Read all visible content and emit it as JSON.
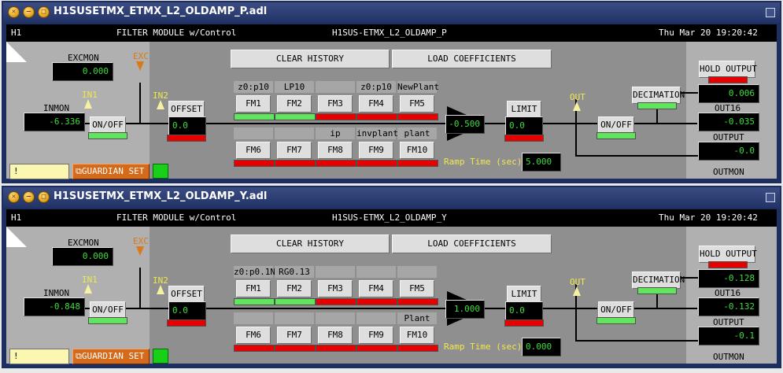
{
  "windows": [
    {
      "title": "H1SUSETMX_ETMX_L2_OLDAMP_P.adl",
      "header": {
        "site": "H1",
        "module_type": "FILTER MODULE w/Control",
        "filter_name": "H1SUS-ETMX_L2_OLDAMP_P",
        "datetime": "Thu Mar 20 19:20:42"
      },
      "excmon": {
        "label": "EXCMON",
        "value": "0.000"
      },
      "exc_label": "EXC",
      "inmon": {
        "label": "INMON",
        "value": "-6.336"
      },
      "in1_label": "IN1",
      "in2_label": "IN2",
      "input_switch": {
        "label": "ON/OFF",
        "state": "on"
      },
      "offset": {
        "label": "OFFSET",
        "value": "0.0",
        "state": "off"
      },
      "clear_history": "CLEAR HISTORY",
      "load_coefficients": "LOAD COEFFICIENTS",
      "filters_top": [
        {
          "name": "z0:p10",
          "button": "FM1",
          "state": "on"
        },
        {
          "name": "LP10",
          "button": "FM2",
          "state": "on"
        },
        {
          "name": "",
          "button": "FM3",
          "state": "off"
        },
        {
          "name": "z0:p10",
          "button": "FM4",
          "state": "off"
        },
        {
          "name": "NewPlant",
          "button": "FM5",
          "state": "off"
        }
      ],
      "filters_bottom": [
        {
          "name": "",
          "button": "FM6",
          "state": "off"
        },
        {
          "name": "",
          "button": "FM7",
          "state": "off"
        },
        {
          "name": "ip",
          "button": "FM8",
          "state": "off"
        },
        {
          "name": "invplant",
          "button": "FM9",
          "state": "off"
        },
        {
          "name": "plant",
          "button": "FM10",
          "state": "off"
        }
      ],
      "gain": "-0.500",
      "limit": {
        "label": "LIMIT",
        "value": "0.0",
        "state": "off"
      },
      "ramp_time": {
        "label": "Ramp Time (sec):",
        "value": "5.000"
      },
      "out_label": "OUT",
      "output_switch": {
        "label": "ON/OFF",
        "state": "on"
      },
      "decimation": {
        "label": "DECIMATION",
        "state": "on"
      },
      "hold_output": {
        "label": "HOLD OUTPUT",
        "state": "off",
        "value": "0.006"
      },
      "out16": {
        "label": "OUT16",
        "value": "-0.035"
      },
      "output": {
        "label": "OUTPUT",
        "value": "-0.0"
      },
      "outmon_label": "OUTMON",
      "status_field": "!",
      "guardian_button": "GUARDIAN SET"
    },
    {
      "title": "H1SUSETMX_ETMX_L2_OLDAMP_Y.adl",
      "header": {
        "site": "H1",
        "module_type": "FILTER MODULE w/Control",
        "filter_name": "H1SUS-ETMX_L2_OLDAMP_Y",
        "datetime": "Thu Mar 20 19:20:42"
      },
      "excmon": {
        "label": "EXCMON",
        "value": "0.000"
      },
      "exc_label": "EXC",
      "inmon": {
        "label": "INMON",
        "value": "-0.848"
      },
      "in1_label": "IN1",
      "in2_label": "IN2",
      "input_switch": {
        "label": "ON/OFF",
        "state": "on"
      },
      "offset": {
        "label": "OFFSET",
        "value": "0.0",
        "state": "off"
      },
      "clear_history": "CLEAR HISTORY",
      "load_coefficients": "LOAD COEFFICIENTS",
      "filters_top": [
        {
          "name": "z0:p0.1N",
          "button": "FM1",
          "state": "on"
        },
        {
          "name": "RG0.13",
          "button": "FM2",
          "state": "on"
        },
        {
          "name": "",
          "button": "FM3",
          "state": "off"
        },
        {
          "name": "",
          "button": "FM4",
          "state": "off"
        },
        {
          "name": "",
          "button": "FM5",
          "state": "off"
        }
      ],
      "filters_bottom": [
        {
          "name": "",
          "button": "FM6",
          "state": "off"
        },
        {
          "name": "",
          "button": "FM7",
          "state": "off"
        },
        {
          "name": "",
          "button": "FM8",
          "state": "off"
        },
        {
          "name": "",
          "button": "FM9",
          "state": "off"
        },
        {
          "name": "Plant",
          "button": "FM10",
          "state": "off"
        }
      ],
      "gain": "1.000",
      "limit": {
        "label": "LIMIT",
        "value": "0.0",
        "state": "off"
      },
      "ramp_time": {
        "label": "Ramp Time (sec):",
        "value": "0.000"
      },
      "out_label": "OUT",
      "output_switch": {
        "label": "ON/OFF",
        "state": "on"
      },
      "decimation": {
        "label": "DECIMATION",
        "state": "on"
      },
      "hold_output": {
        "label": "HOLD OUTPUT",
        "state": "off",
        "value": "-0.128"
      },
      "out16": {
        "label": "OUT16",
        "value": "-0.132"
      },
      "output": {
        "label": "OUTPUT",
        "value": "-0.1"
      },
      "outmon_label": "OUTMON",
      "status_field": "!",
      "guardian_button": "GUARDIAN SET"
    }
  ],
  "colors": {
    "on": "#61e55f",
    "off": "#e60000",
    "readback": "#3fdc3f",
    "title_bar": "#223466",
    "panel": "#b0b0b0",
    "inner_panel": "#8f8f8f"
  }
}
